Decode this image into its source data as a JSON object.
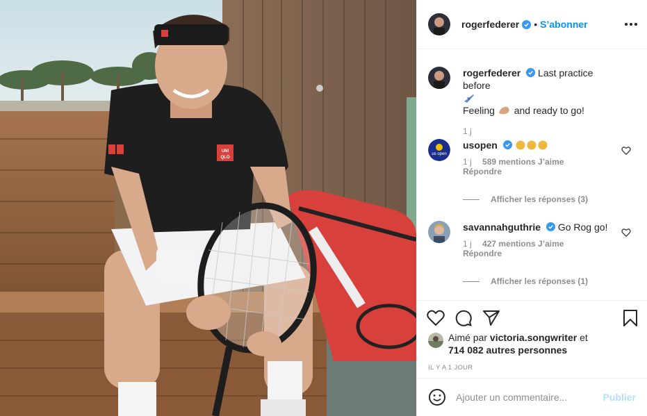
{
  "post": {
    "author": "rogerfederer",
    "follow_label": "S’abonner",
    "separator": "•"
  },
  "caption": {
    "author": "rogerfederer",
    "text_line1": "Last practice before",
    "text_line2_a": "Feeling",
    "text_line2_b": "and ready to go!",
    "time": "1 j"
  },
  "comments": [
    {
      "author": "usopen",
      "text": "",
      "time": "1 j",
      "likes": "589 mentions J’aime",
      "reply_label": "Répondre",
      "show_replies": "Afficher les réponses (3)"
    },
    {
      "author": "savannahguthrie",
      "text": "Go Rog go!",
      "time": "1 j",
      "likes": "427 mentions J’aime",
      "reply_label": "Répondre",
      "show_replies": "Afficher les réponses (1)"
    }
  ],
  "likes": {
    "prefix": "Aimé par",
    "user": "victoria.songwriter",
    "and": "et",
    "others": "714 082 autres personnes"
  },
  "timestamp": "IL Y A 1 JOUR",
  "add_comment": {
    "placeholder": "Ajouter un commentaire...",
    "post_label": "Publier"
  },
  "photo": {
    "shirt_brand": "UNI QLO"
  },
  "colors": {
    "accent": "#0095f6",
    "verified": "#3897f0",
    "muted": "#8e8e8e",
    "text": "#262626"
  },
  "icons": {
    "verified": "verified-badge-icon",
    "more": "more-options-icon",
    "like": "heart-icon",
    "comment": "comment-icon",
    "share": "paper-plane-icon",
    "save": "bookmark-icon",
    "emoji": "smiley-icon"
  }
}
